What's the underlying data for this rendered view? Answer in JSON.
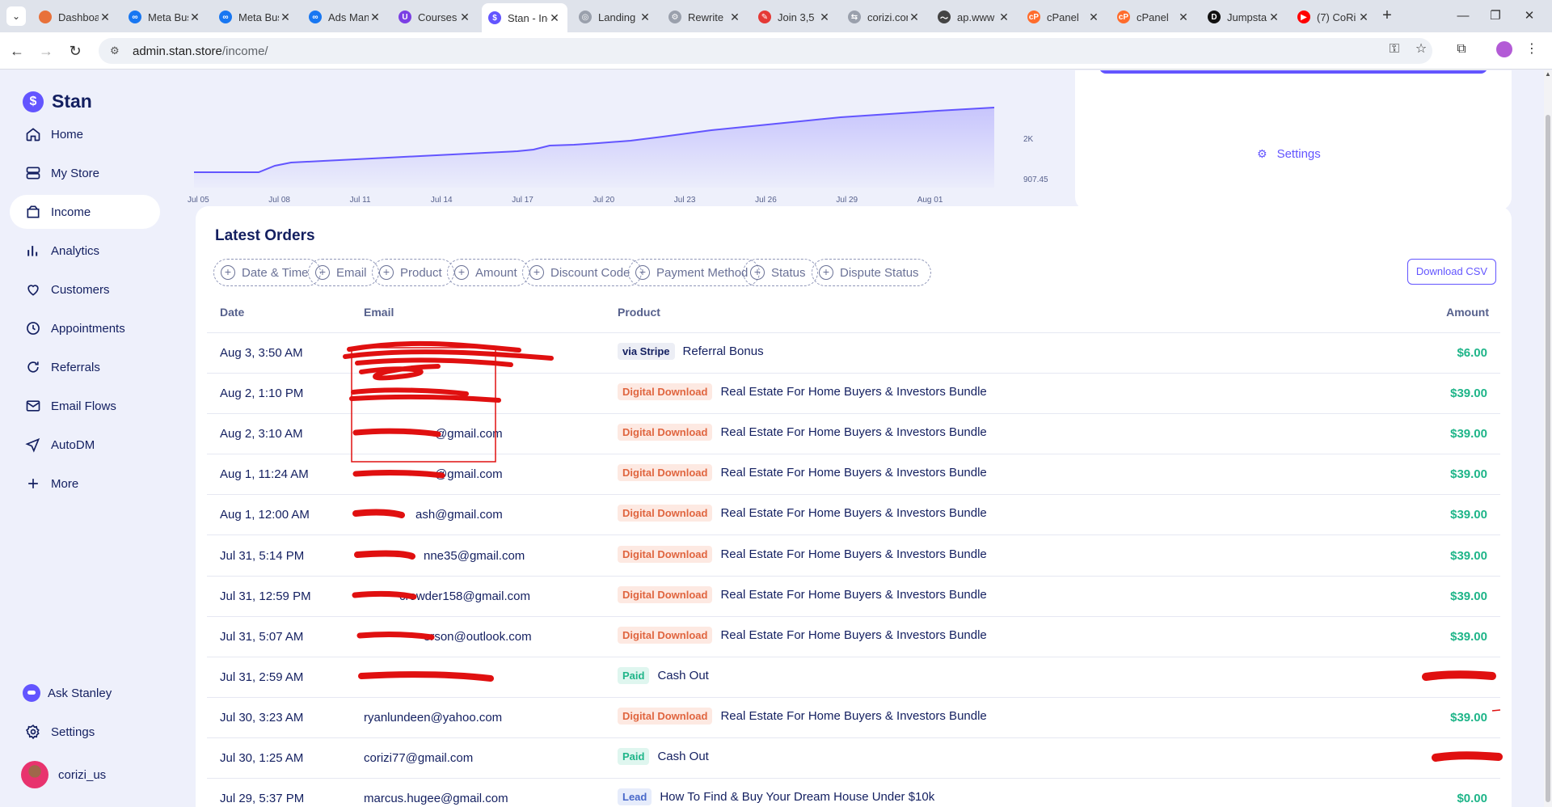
{
  "browser": {
    "tabs": [
      {
        "title": "Dashboard",
        "color": "#e8713a",
        "glyph": ""
      },
      {
        "title": "Meta Business",
        "color": "#1877f2",
        "glyph": "∞"
      },
      {
        "title": "Meta Business",
        "color": "#1877f2",
        "glyph": "∞"
      },
      {
        "title": "Ads Manager",
        "color": "#1877f2",
        "glyph": "∞"
      },
      {
        "title": "Courses",
        "color": "#7b3fe4",
        "glyph": "U"
      },
      {
        "title": "Stan - Income",
        "color": "#6355ff",
        "glyph": "$"
      },
      {
        "title": "Landing Page",
        "color": "#9aa0ac",
        "glyph": "◎"
      },
      {
        "title": "Rewrite",
        "color": "#9aa0ac",
        "glyph": "⚙"
      },
      {
        "title": "Join 3,5",
        "color": "#e53935",
        "glyph": "✎"
      },
      {
        "title": "corizi.com",
        "color": "#9aa0ac",
        "glyph": "⇆"
      },
      {
        "title": "ap.www",
        "color": "#444",
        "glyph": "〜"
      },
      {
        "title": "cPanel",
        "color": "#ff6c2c",
        "glyph": "cP"
      },
      {
        "title": "cPanel",
        "color": "#ff6c2c",
        "glyph": "cP"
      },
      {
        "title": "Jumpstart",
        "color": "#111",
        "glyph": "D"
      },
      {
        "title": "(7) CoRi",
        "color": "#ff0000",
        "glyph": "▶"
      }
    ],
    "url_host": "admin.stan.store",
    "url_path": "/income/"
  },
  "sidebar": {
    "brand": "Stan",
    "items": [
      {
        "label": "Home",
        "icon": "home-icon"
      },
      {
        "label": "My Store",
        "icon": "store-icon"
      },
      {
        "label": "Income",
        "icon": "wallet-icon"
      },
      {
        "label": "Analytics",
        "icon": "analytics-icon"
      },
      {
        "label": "Customers",
        "icon": "heart-icon"
      },
      {
        "label": "Appointments",
        "icon": "clock-icon"
      },
      {
        "label": "Referrals",
        "icon": "refresh-icon"
      },
      {
        "label": "Email Flows",
        "icon": "mail-icon"
      },
      {
        "label": "AutoDM",
        "icon": "send-icon"
      },
      {
        "label": "More",
        "icon": "plus-icon"
      }
    ],
    "ask": "Ask Stanley",
    "settings": "Settings",
    "user": "corizi_us"
  },
  "chart_data": {
    "type": "area",
    "x": [
      "Jul 05",
      "Jul 08",
      "Jul 11",
      "Jul 14",
      "Jul 17",
      "Jul 20",
      "Jul 23",
      "Jul 26",
      "Jul 29",
      "Aug 01"
    ],
    "y_ticks": [
      "2K",
      "907.45"
    ],
    "color": "#6355ff"
  },
  "settings_card": {
    "label": "Settings"
  },
  "orders": {
    "title": "Latest Orders",
    "filters": [
      "Date & Time",
      "Email",
      "Product",
      "Amount",
      "Discount Code",
      "Payment Method",
      "Status",
      "Dispute Status"
    ],
    "download": "Download CSV",
    "columns": {
      "date": "Date",
      "email": "Email",
      "product": "Product",
      "amount": "Amount"
    },
    "rows": [
      {
        "date": "Aug 3, 3:50 AM",
        "email": "",
        "badge": "via Stripe",
        "badge_type": "stripe",
        "product": "Referral Bonus",
        "amount": "$6.00"
      },
      {
        "date": "Aug 2, 1:10 PM",
        "email": "",
        "badge": "Digital Download",
        "badge_type": "dd",
        "product": "Real Estate For Home Buyers & Investors Bundle",
        "amount": "$39.00"
      },
      {
        "date": "Aug 2, 3:10 AM",
        "email": "@gmail.com",
        "badge": "Digital Download",
        "badge_type": "dd",
        "product": "Real Estate For Home Buyers & Investors Bundle",
        "amount": "$39.00"
      },
      {
        "date": "Aug 1, 11:24 AM",
        "email": "@gmail.com",
        "badge": "Digital Download",
        "badge_type": "dd",
        "product": "Real Estate For Home Buyers & Investors Bundle",
        "amount": "$39.00"
      },
      {
        "date": "Aug 1, 12:00 AM",
        "email": "ash@gmail.com",
        "badge": "Digital Download",
        "badge_type": "dd",
        "product": "Real Estate For Home Buyers & Investors Bundle",
        "amount": "$39.00"
      },
      {
        "date": "Jul 31, 5:14 PM",
        "email": "nne35@gmail.com",
        "badge": "Digital Download",
        "badge_type": "dd",
        "product": "Real Estate For Home Buyers & Investors Bundle",
        "amount": "$39.00"
      },
      {
        "date": "Jul 31, 12:59 PM",
        "email": "crowder158@gmail.com",
        "badge": "Digital Download",
        "badge_type": "dd",
        "product": "Real Estate For Home Buyers & Investors Bundle",
        "amount": "$39.00"
      },
      {
        "date": "Jul 31, 5:07 AM",
        "email": "erson@outlook.com",
        "badge": "Digital Download",
        "badge_type": "dd",
        "product": "Real Estate For Home Buyers & Investors Bundle",
        "amount": "$39.00"
      },
      {
        "date": "Jul 31, 2:59 AM",
        "email": "",
        "badge": "Paid",
        "badge_type": "paid",
        "product": "Cash Out",
        "amount": ""
      },
      {
        "date": "Jul 30, 3:23 AM",
        "email": "ryanlundeen@yahoo.com",
        "badge": "Digital Download",
        "badge_type": "dd",
        "product": "Real Estate For Home Buyers & Investors Bundle",
        "amount": "$39.00"
      },
      {
        "date": "Jul 30, 1:25 AM",
        "email": "corizi77@gmail.com",
        "badge": "Paid",
        "badge_type": "paid",
        "product": "Cash Out",
        "amount": ""
      },
      {
        "date": "Jul 29, 5:37 PM",
        "email": "marcus.hugee@gmail.com",
        "badge": "Lead",
        "badge_type": "lead",
        "product": "How To Find & Buy Your Dream House Under $10k",
        "amount": "$0.00"
      }
    ]
  }
}
